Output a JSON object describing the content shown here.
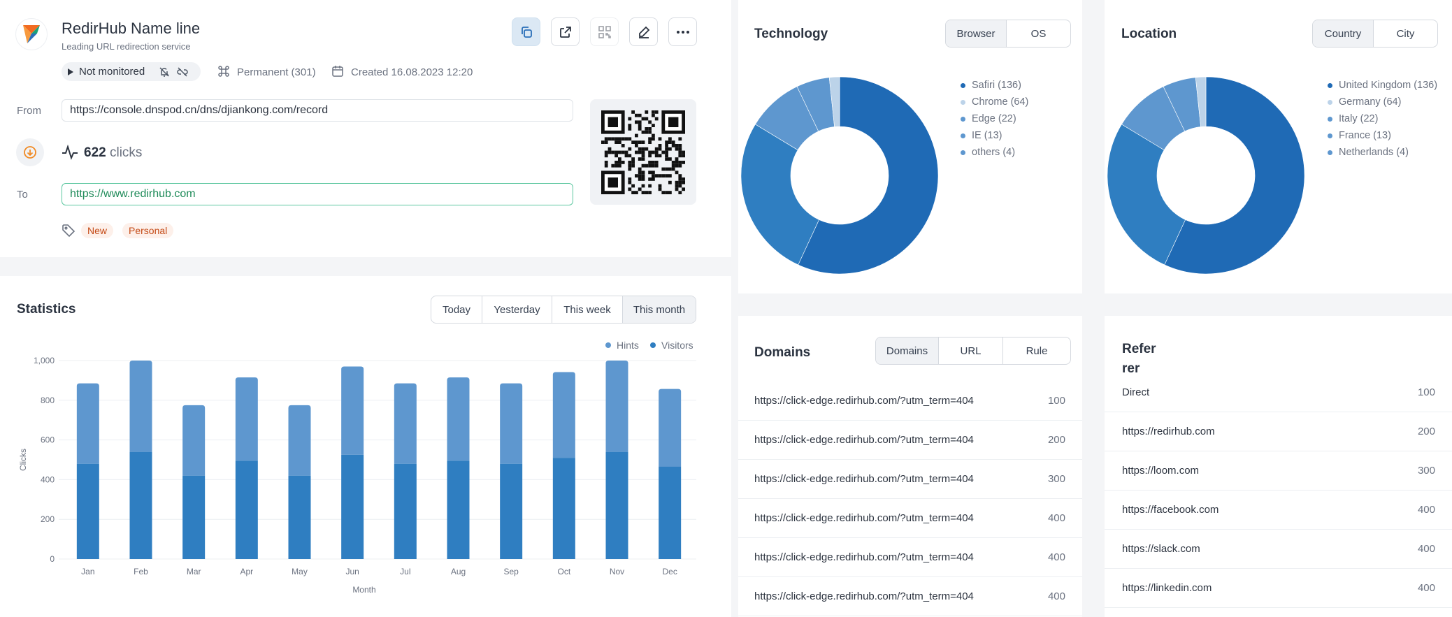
{
  "link": {
    "name": "RedirHub Name line",
    "subtitle": "Leading URL redirection service",
    "monitor_status": "Not monitored",
    "redirect_type": "Permanent (301)",
    "created": "Created 16.08.2023 12:20",
    "from_label": "From",
    "from_url": "https://console.dnspod.cn/dns/djiankong.com/record",
    "clicks_count": "622",
    "clicks_label": "clicks",
    "to_label": "To",
    "to_url": "https://www.redirhub.com",
    "tags": [
      "New",
      "Personal"
    ]
  },
  "technology": {
    "title": "Technology",
    "tabs": [
      "Browser",
      "OS"
    ],
    "active_tab": "Browser",
    "legend": [
      "Safiri (136)",
      "Chrome (64)",
      "Edge (22)",
      "IE (13)",
      "others (4)"
    ]
  },
  "location": {
    "title": "Location",
    "tabs": [
      "Country",
      "City"
    ],
    "active_tab": "Country",
    "legend": [
      "United Kingdom (136)",
      "Germany (64)",
      "Italy (22)",
      "France (13)",
      "Netherlands (4)"
    ]
  },
  "statistics": {
    "title": "Statistics",
    "ranges": [
      "Today",
      "Yesterday",
      "This week",
      "This month"
    ],
    "active_range": "This month"
  },
  "domains": {
    "title": "Domains",
    "tabs": [
      "Domains",
      "URL",
      "Rule"
    ],
    "active_tab": "Domains",
    "rows": [
      {
        "label": "https://click-edge.redirhub.com/?utm_term=404",
        "value": "100"
      },
      {
        "label": "https://click-edge.redirhub.com/?utm_term=404",
        "value": "200"
      },
      {
        "label": "https://click-edge.redirhub.com/?utm_term=404",
        "value": "300"
      },
      {
        "label": "https://click-edge.redirhub.com/?utm_term=404",
        "value": "400"
      },
      {
        "label": "https://click-edge.redirhub.com/?utm_term=404",
        "value": "400"
      },
      {
        "label": "https://click-edge.redirhub.com/?utm_term=404",
        "value": "400"
      }
    ]
  },
  "referrer": {
    "title_line1": "Refer",
    "title_line2": "rer",
    "rows": [
      {
        "label": "Direct",
        "value": "100"
      },
      {
        "label": "https://redirhub.com",
        "value": "200"
      },
      {
        "label": "https://loom.com",
        "value": "300"
      },
      {
        "label": "https://facebook.com",
        "value": "400"
      },
      {
        "label": "https://slack.com",
        "value": "400"
      },
      {
        "label": "https://linkedin.com",
        "value": "400"
      }
    ]
  },
  "colors": {
    "dark": "#1f6ab5",
    "mid": "#2f7ec1",
    "light": "#5e97cf",
    "pale": "#bcd3e9",
    "accent_green": "#1e9a63"
  },
  "chart_data": [
    {
      "type": "bar",
      "stacked": true,
      "categories": [
        "Jan",
        "Feb",
        "Mar",
        "Apr",
        "May",
        "Jun",
        "Jul",
        "Aug",
        "Sep",
        "Oct",
        "Nov",
        "Dec"
      ],
      "series": [
        {
          "name": "Visitors",
          "values": [
            480,
            540,
            420,
            495,
            420,
            525,
            480,
            495,
            480,
            510,
            540,
            465
          ]
        },
        {
          "name": "Hints",
          "values": [
            405,
            460,
            355,
            420,
            355,
            445,
            405,
            420,
            405,
            432,
            460,
            392
          ]
        }
      ],
      "xlabel": "Month",
      "ylabel": "Clicks",
      "ylim": [
        0,
        1000
      ],
      "yticks": [
        "0",
        "200",
        "400",
        "600",
        "800",
        "1,000"
      ],
      "grid": true,
      "legend_position": "top-right"
    },
    {
      "type": "pie",
      "donut": true,
      "labels": [
        "Safiri",
        "Chrome",
        "Edge",
        "IE",
        "others"
      ],
      "values": [
        136,
        64,
        22,
        13,
        4
      ]
    },
    {
      "type": "pie",
      "donut": true,
      "labels": [
        "United Kingdom",
        "Germany",
        "Italy",
        "France",
        "Netherlands"
      ],
      "values": [
        136,
        64,
        22,
        13,
        4
      ]
    }
  ]
}
